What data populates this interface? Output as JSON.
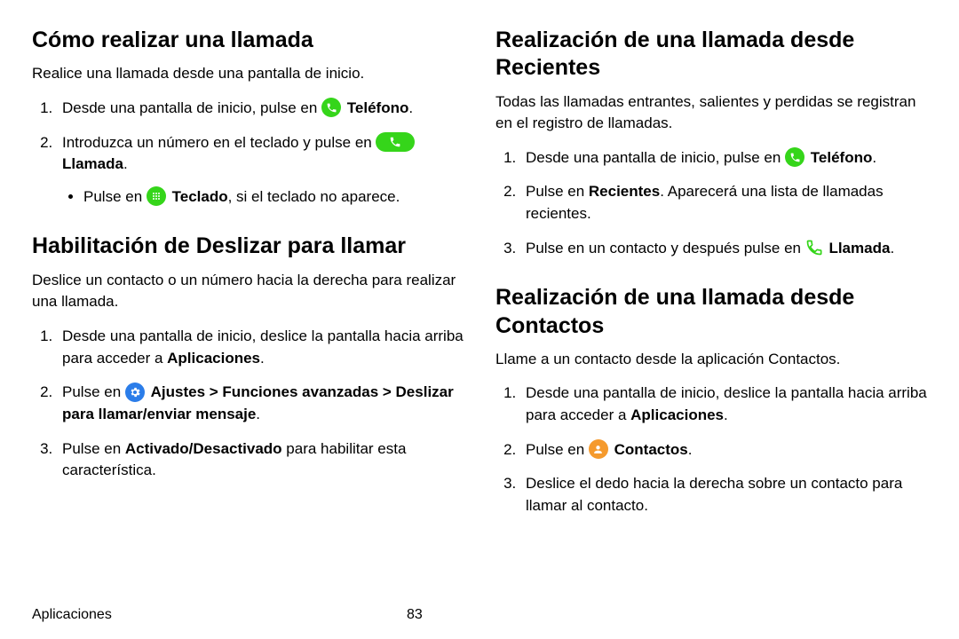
{
  "footer": {
    "label": "Aplicaciones",
    "page": "83"
  },
  "left": {
    "s1": {
      "heading": "Cómo realizar una llamada",
      "lead": "Realice una llamada desde una pantalla de inicio.",
      "i1a": "Desde una pantalla de inicio, pulse en ",
      "i1b": "Teléfono",
      "i1c": ".",
      "i2a": "Introduzca un número en el teclado y pulse en ",
      "i2b": "Llamada",
      "i2c": ".",
      "i2s1a": "Pulse en ",
      "i2s1b": "Teclado",
      "i2s1c": ", si el teclado no aparece."
    },
    "s2": {
      "heading": "Habilitación de Deslizar para llamar",
      "lead": "Deslice un contacto o un número hacia la derecha para realizar una llamada.",
      "i1a": "Desde una pantalla de inicio, deslice la pantalla hacia arriba para acceder a ",
      "i1b": "Aplicaciones",
      "i1c": ".",
      "i2a": "Pulse en ",
      "i2b": "Ajustes",
      "i2c": " > ",
      "i2d": "Funciones avanzadas",
      "i2e": " > ",
      "i2f": "Deslizar para llamar/enviar mensaje",
      "i2g": ".",
      "i3a": "Pulse en ",
      "i3b": "Activado/Desactivado",
      "i3c": " para habilitar esta característica."
    }
  },
  "right": {
    "s3": {
      "heading": "Realización de una llamada desde Recientes",
      "lead": "Todas las llamadas entrantes, salientes y perdidas se registran en el registro de llamadas.",
      "i1a": "Desde una pantalla de inicio, pulse en ",
      "i1b": "Teléfono",
      "i1c": ".",
      "i2a": "Pulse en ",
      "i2b": "Recientes",
      "i2c": ". Aparecerá una lista de llamadas recientes.",
      "i3a": "Pulse en un contacto y después pulse en ",
      "i3b": "Llamada",
      "i3c": "."
    },
    "s4": {
      "heading": "Realización de una llamada desde Contactos",
      "lead": "Llame a un contacto desde la aplicación Contactos.",
      "i1a": "Desde una pantalla de inicio, deslice la pantalla hacia arriba para acceder a ",
      "i1b": "Aplicaciones",
      "i1c": ".",
      "i2a": "Pulse en ",
      "i2b": "Contactos",
      "i2c": ".",
      "i3": "Deslice el dedo hacia la derecha sobre un contacto para llamar al contacto."
    }
  }
}
